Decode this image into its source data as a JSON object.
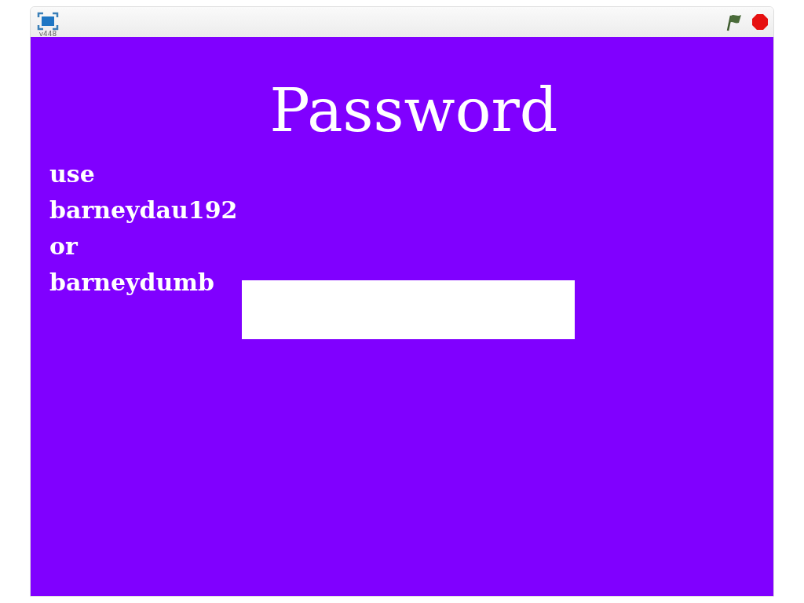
{
  "player": {
    "version": "v448"
  },
  "stage": {
    "title": "Password",
    "hint_lines": [
      "use",
      "barneydau192",
      "or",
      "barneydumb"
    ]
  }
}
